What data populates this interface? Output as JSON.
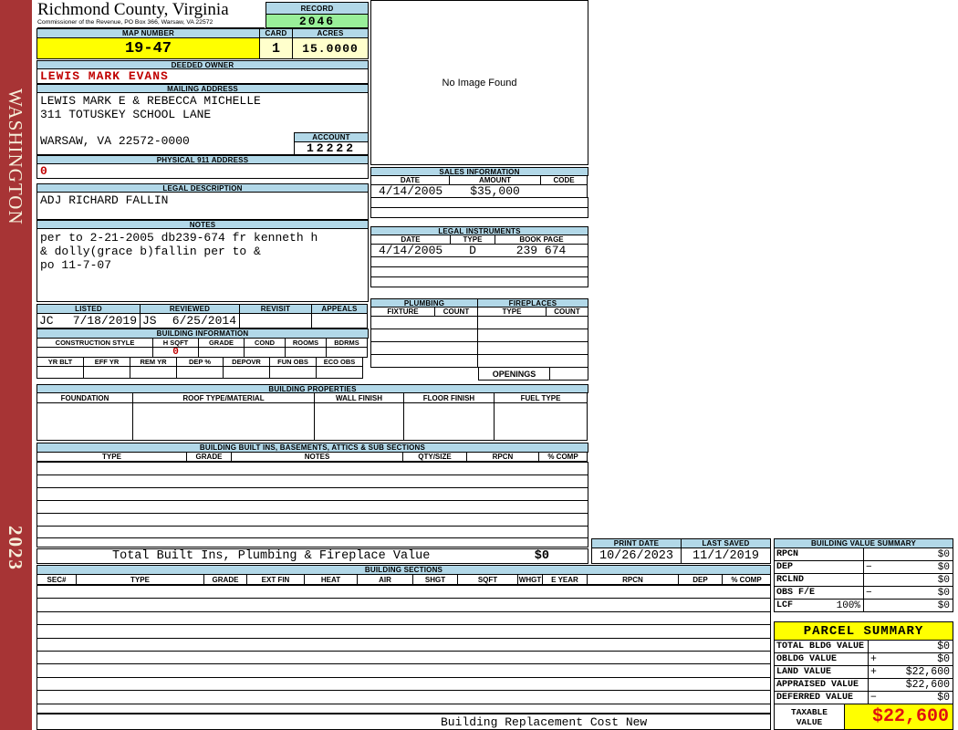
{
  "colors": {
    "accent_blue": "#B2D8E8",
    "record_green": "#99EF99",
    "highlight_yellow": "#FFFF00",
    "soft_yellow": "#FFFFCC",
    "sidebar_red": "#A73435",
    "alert_red": "#C00000",
    "taxable_red": "#E01111"
  },
  "sidebar": {
    "state": "WASHINGTON",
    "year": "2023"
  },
  "header": {
    "county": "Richmond County, Virginia",
    "commissioner_line": "Commissioner of the Revenue, PO Box 366, Warsaw, VA 22572",
    "record_label": "RECORD",
    "record_value": "2046",
    "map_number_label": "MAP NUMBER",
    "map_number_value": "19-47",
    "card_label": "CARD",
    "card_value": "1",
    "acres_label": "ACRES",
    "acres_value": "15.0000"
  },
  "owner": {
    "deeded_owner_label": "DEEDED OWNER",
    "deeded_owner": "LEWIS MARK EVANS",
    "mailing_address_label": "MAILING ADDRESS",
    "mailing_lines": [
      "LEWIS MARK E & REBECCA MICHELLE",
      "311 TOTUSKEY SCHOOL LANE",
      "WARSAW, VA 22572-0000"
    ],
    "account_label": "ACCOUNT",
    "account_value": "12222",
    "physical_911_label": "PHYSICAL 911 ADDRESS",
    "physical_911_value": "0"
  },
  "legal_description": {
    "label": "LEGAL DESCRIPTION",
    "value": "ADJ RICHARD FALLIN"
  },
  "notes": {
    "label": "NOTES",
    "lines": [
      "per to 2-21-2005 db239-674 fr kenneth h",
      "& dolly(grace b)fallin per to &",
      "po 11-7-07"
    ]
  },
  "image_panel": {
    "placeholder": "No Image Found"
  },
  "sales": {
    "title": "SALES INFORMATION",
    "headers": [
      "DATE",
      "AMOUNT",
      "CODE"
    ],
    "rows": [
      {
        "date": "4/14/2005",
        "amount": "$35,000",
        "code": ""
      }
    ]
  },
  "instruments": {
    "title": "LEGAL INSTRUMENTS",
    "headers": [
      "DATE",
      "TYPE",
      "BOOK PAGE"
    ],
    "rows": [
      {
        "date": "4/14/2005",
        "type": "D",
        "book_page": "239 674"
      }
    ]
  },
  "plumbing": {
    "title": "PLUMBING",
    "headers": [
      "FIXTURE",
      "COUNT"
    ]
  },
  "fireplaces": {
    "title": "FIREPLACES",
    "headers": [
      "TYPE",
      "COUNT"
    ],
    "openings_label": "OPENINGS"
  },
  "review": {
    "listed_label": "LISTED",
    "listed_by": "JC",
    "listed_date": "7/18/2019",
    "reviewed_label": "REVIEWED",
    "reviewed_by": "JS",
    "reviewed_date": "6/25/2014",
    "revisit_label": "REVISIT",
    "appeals_label": "APPEALS"
  },
  "building_info": {
    "title": "BUILDING INFORMATION",
    "row1_headers": [
      "CONSTRUCTION STYLE",
      "H SQFT",
      "GRADE",
      "COND",
      "ROOMS",
      "BDRMS"
    ],
    "h_sqft_value": "0",
    "row2_headers": [
      "YR BLT",
      "EFF YR",
      "REM YR",
      "DEP %",
      "DEPOVR",
      "FUN OBS",
      "ECO OBS"
    ]
  },
  "building_properties": {
    "title": "BUILDING PROPERTIES",
    "headers": [
      "FOUNDATION",
      "ROOF TYPE/MATERIAL",
      "WALL FINISH",
      "FLOOR FINISH",
      "FUEL TYPE"
    ]
  },
  "built_ins": {
    "title": "BUILDING BUILT INS, BASEMENTS, ATTICS & SUB SECTIONS",
    "headers": [
      "TYPE",
      "GRADE",
      "NOTES",
      "QTY/SIZE",
      "RPCN",
      "% COMP"
    ],
    "total_label": "Total Built Ins, Plumbing & Fireplace Value",
    "total_value": "$0"
  },
  "print_info": {
    "print_date_label": "PRINT DATE",
    "print_date": "10/26/2023",
    "last_saved_label": "LAST SAVED",
    "last_saved": "11/1/2019"
  },
  "building_sections": {
    "title": "BUILDING SECTIONS",
    "headers": [
      "SEC#",
      "TYPE",
      "GRADE",
      "EXT FIN",
      "HEAT",
      "AIR",
      "SHGT",
      "SQFT",
      "WHGT",
      "E YEAR",
      "RPCN",
      "DEP",
      "% COMP"
    ],
    "footer": "Building Replacement Cost New"
  },
  "building_value_summary": {
    "title": "BUILDING VALUE SUMMARY",
    "rows": [
      {
        "label": "RPCN",
        "pct": "",
        "op": "",
        "value": "$0"
      },
      {
        "label": "DEP",
        "pct": "",
        "op": "−",
        "value": "$0"
      },
      {
        "label": "RCLND",
        "pct": "",
        "op": "",
        "value": "$0"
      },
      {
        "label": "OBS F/E",
        "pct": "",
        "op": "−",
        "value": "$0"
      },
      {
        "label": "LCF",
        "pct": "100%",
        "op": "",
        "value": "$0"
      }
    ]
  },
  "parcel_summary": {
    "title": "PARCEL SUMMARY",
    "rows": [
      {
        "label": "TOTAL BLDG VALUE",
        "op": "",
        "value": "$0"
      },
      {
        "label": "OBLDG VALUE",
        "op": "+",
        "value": "$0"
      },
      {
        "label": "LAND VALUE",
        "op": "+",
        "value": "$22,600"
      },
      {
        "label": "APPRAISED VALUE",
        "op": "",
        "value": "$22,600"
      },
      {
        "label": "DEFERRED VALUE",
        "op": "−",
        "value": "$0"
      }
    ],
    "taxable_label_line1": "TAXABLE",
    "taxable_label_line2": "VALUE",
    "taxable_value": "$22,600"
  }
}
